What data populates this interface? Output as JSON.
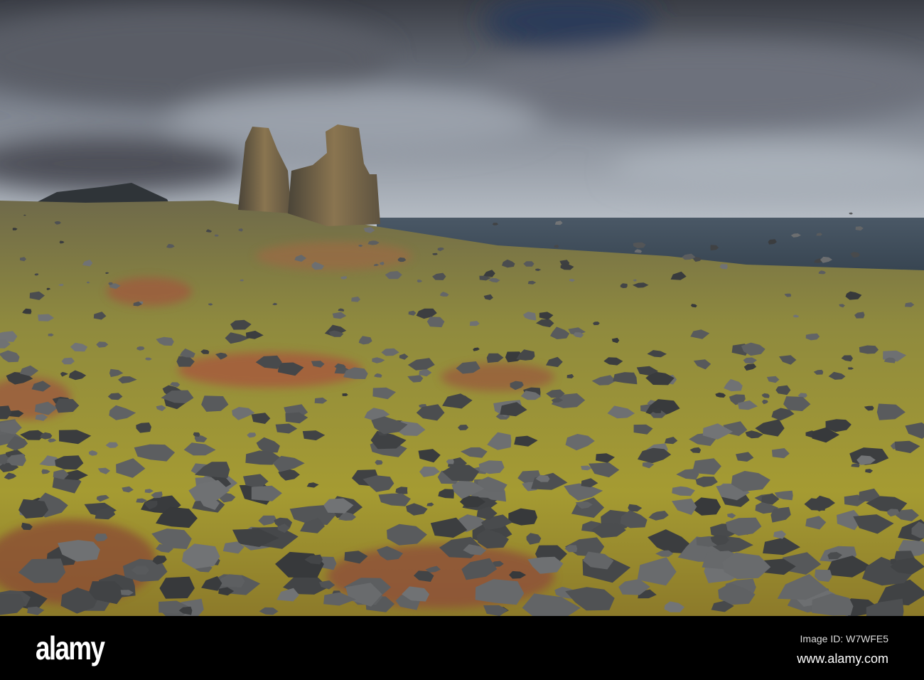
{
  "photo": {
    "subject": "Coastal lava field with moss and rock pillars by the sea"
  },
  "watermark": {
    "logo_text": "alamy",
    "image_id": "Image ID: W7WFE5",
    "url": "www.alamy.com"
  },
  "colors": {
    "sky_top": "#3e4149",
    "sky_mid": "#8d939e",
    "sea": "#3b4a58",
    "moss": "#a39a36",
    "heather": "#a0583e",
    "rock": "#4e5052"
  }
}
